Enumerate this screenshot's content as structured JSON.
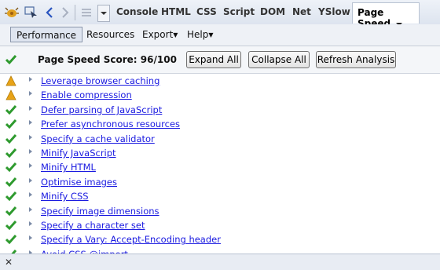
{
  "toolbar": {
    "tabs": [
      "Console",
      "HTML",
      "CSS",
      "Script",
      "DOM",
      "Net",
      "YSlow"
    ],
    "active_tab": "Page Speed",
    "icons": [
      "firebug-icon",
      "inspect-icon",
      "back-icon",
      "forward-icon",
      "list-icon",
      "dropdown-icon"
    ]
  },
  "menubar": {
    "items": [
      "Performance",
      "Resources",
      "Export",
      "Help"
    ],
    "selected": "Performance"
  },
  "scorebar": {
    "score_text": "Page Speed Score: 96/100",
    "buttons": [
      "Expand All",
      "Collapse All",
      "Refresh Analysis"
    ]
  },
  "rules": [
    {
      "label": "Leverage browser caching",
      "status": "warning"
    },
    {
      "label": "Enable compression",
      "status": "warning"
    },
    {
      "label": "Defer parsing of JavaScript",
      "status": "pass"
    },
    {
      "label": "Prefer asynchronous resources",
      "status": "pass"
    },
    {
      "label": "Specify a cache validator",
      "status": "pass"
    },
    {
      "label": "Minify JavaScript",
      "status": "pass"
    },
    {
      "label": "Minify HTML",
      "status": "pass"
    },
    {
      "label": "Optimise images",
      "status": "pass"
    },
    {
      "label": "Minify CSS",
      "status": "pass"
    },
    {
      "label": "Specify image dimensions",
      "status": "pass"
    },
    {
      "label": "Specify a character set",
      "status": "pass"
    },
    {
      "label": "Specify a Vary: Accept-Encoding header",
      "status": "pass"
    },
    {
      "label": "Avoid CSS @import",
      "status": "pass"
    }
  ],
  "colors": {
    "link": "#1a1ae0",
    "pass": "#2e9a2e",
    "warning": "#e8a317"
  },
  "statusbar": {
    "close_icon": "close-icon"
  }
}
